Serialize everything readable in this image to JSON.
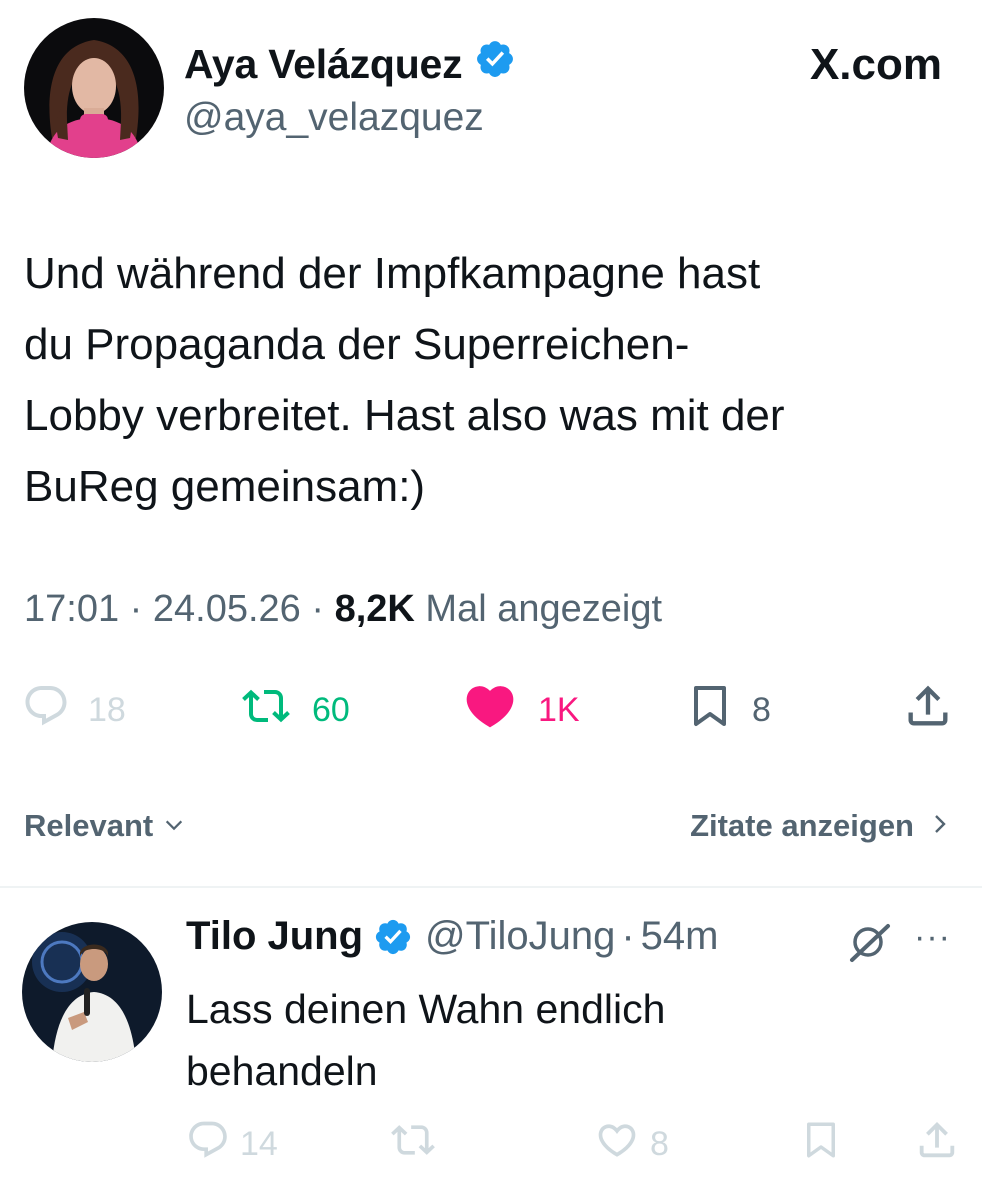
{
  "tweet": {
    "author_name": "Aya Velázquez",
    "author_handle": "@aya_velazquez",
    "verified_icon": "verified-badge-icon",
    "site_label": "X.com",
    "text_lines": [
      "Und während der Impfkampagne hast",
      "du Propaganda der Superreichen-",
      "Lobby verbreitet. Hast also was mit der",
      "BuReg gemeinsam:)"
    ],
    "time": "17:01",
    "date": "24.05.26",
    "separator": " · ",
    "views": "8,2K",
    "views_label": "Mal angezeigt",
    "stats": {
      "replies": "18",
      "retweets": "60",
      "likes": "1K",
      "bookmarks": "8"
    }
  },
  "sort": {
    "relevant_label": "Relevant",
    "quotes_label": "Zitate anzeigen"
  },
  "reply": {
    "author_name": "Tilo Jung",
    "author_handle": "@TiloJung",
    "dot": "·",
    "time": "54m",
    "more": "···",
    "text_lines": [
      "Lass deinen Wahn endlich",
      "behandeln"
    ],
    "stats": {
      "replies": "14",
      "likes": "8"
    }
  },
  "colors": {
    "text": "#0f1419",
    "muted": "#536471",
    "faint": "#cfd9de",
    "verified": "#1d9bf0",
    "retweet": "#00ba7c",
    "like": "#f91880",
    "divider": "#eff3f4"
  }
}
